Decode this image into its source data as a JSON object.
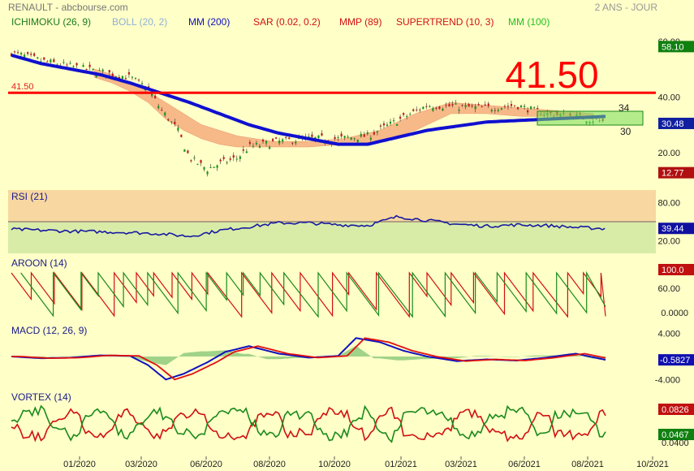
{
  "header": {
    "title": "RENAULT - abcbourse.com",
    "period": "2 ANS - JOUR",
    "indicators": [
      {
        "label": "ICHIMOKU (26, 9)",
        "color": "#1a7a1a"
      },
      {
        "label": "BOLL (20, 2)",
        "color": "#8fb0d8"
      },
      {
        "label": "MM (200)",
        "color": "#1010c0"
      },
      {
        "label": "SAR (0.02, 0.2)",
        "color": "#d01010"
      },
      {
        "label": "MMP (89)",
        "color": "#d01010"
      },
      {
        "label": "SUPERTREND (10, 3)",
        "color": "#d01010"
      },
      {
        "label": "MM (100)",
        "color": "#20c020"
      }
    ]
  },
  "chart_data": [
    {
      "type": "line",
      "panel": "price",
      "y_ticks": [
        "60.00",
        "40.00",
        "20.00"
      ],
      "ylim": [
        8,
        62
      ],
      "horizontal_level": 41.5,
      "level_label_big": "41.50",
      "level_label_small": "41.50",
      "box_label_top": "34",
      "box_label_bottom": "30",
      "value_tags": [
        {
          "text": "58.10",
          "value": 58.1,
          "bg": "#108010"
        },
        {
          "text": "30.48",
          "value": 30.48,
          "bg": "#1020a0"
        },
        {
          "text": "12.77",
          "value": 12.77,
          "bg": "#b01010"
        }
      ],
      "series": [
        {
          "name": "Prix",
          "x": [
            0,
            5,
            10,
            15,
            20,
            23,
            25,
            28,
            30,
            33,
            35,
            38,
            40,
            45,
            50,
            55,
            60,
            70,
            80,
            85,
            88,
            90,
            95,
            100
          ],
          "values": [
            56,
            53,
            51,
            49,
            47,
            43,
            36,
            28,
            18,
            14,
            16,
            18,
            22,
            24,
            25,
            25,
            26,
            37,
            36,
            37,
            35,
            34,
            33,
            31
          ]
        },
        {
          "name": "MM (200)",
          "x": [
            0,
            5,
            10,
            15,
            20,
            30,
            40,
            45,
            50,
            55,
            60,
            70,
            80,
            90,
            100
          ],
          "values": [
            55,
            52,
            50,
            48,
            45,
            38,
            30,
            27,
            25,
            23,
            23,
            28,
            31,
            32,
            33
          ]
        }
      ],
      "zones": [
        {
          "name": "Ichimoku",
          "x": [
            14,
            17,
            20,
            23,
            26,
            29,
            32,
            35,
            38,
            41,
            44,
            50,
            56,
            62,
            68,
            74,
            80,
            86,
            92,
            98
          ],
          "top": [
            50,
            48,
            45,
            42,
            38,
            34,
            30,
            28,
            26,
            25,
            24,
            24,
            25,
            28,
            34,
            38,
            37,
            36,
            35,
            34
          ],
          "bottom": [
            47,
            45,
            42,
            38,
            32,
            28,
            25,
            23,
            22,
            22,
            22,
            22,
            23,
            24,
            28,
            34,
            34,
            33,
            33,
            32
          ]
        }
      ]
    },
    {
      "type": "line",
      "panel": "RSI",
      "title": "RSI (21)",
      "y_ticks": [
        "80.00",
        "20.00"
      ],
      "ylim": [
        0,
        100
      ],
      "value_tag": {
        "text": "39.44",
        "value": 39.44,
        "bg": "#1010a0"
      },
      "series": [
        {
          "name": "RSI (21)",
          "x": [
            0,
            10,
            20,
            25,
            30,
            35,
            40,
            45,
            50,
            55,
            60,
            65,
            70,
            75,
            80,
            85,
            90,
            95,
            100
          ],
          "values": [
            38,
            35,
            33,
            31,
            27,
            36,
            42,
            48,
            48,
            45,
            44,
            58,
            52,
            46,
            43,
            45,
            44,
            41,
            39
          ]
        }
      ]
    },
    {
      "type": "line",
      "panel": "AROON",
      "title": "AROON (14)",
      "y_ticks": [
        "60.00",
        "0.0000"
      ],
      "ylim": [
        0,
        100
      ],
      "value_tag": {
        "text": "100.0",
        "value": 100,
        "bg": "#c01010"
      }
    },
    {
      "type": "line",
      "panel": "MACD",
      "title": "MACD (12, 26, 9)",
      "y_ticks": [
        "4.000",
        "-4.000"
      ],
      "ylim": [
        -5.5,
        5.5
      ],
      "value_tag": {
        "text": "-0.5827",
        "value": -0.5827,
        "bg": "#1010b0"
      },
      "series": [
        {
          "name": "MACD",
          "x": [
            0,
            5,
            10,
            15,
            20,
            23,
            26,
            29,
            33,
            36,
            40,
            45,
            50,
            55,
            58,
            62,
            66,
            70,
            75,
            80,
            85,
            90,
            95,
            100
          ],
          "values": [
            0,
            -0.3,
            -0.2,
            0.2,
            0.1,
            -1.5,
            -4,
            -3,
            -1,
            0.8,
            1.8,
            0.5,
            -0.2,
            0.1,
            3.2,
            2.5,
            1,
            0,
            -0.8,
            -0.5,
            -0.7,
            -0.2,
            0.5,
            -0.58
          ]
        }
      ]
    },
    {
      "type": "line",
      "panel": "VORTEX",
      "title": "VORTEX (14)",
      "value_tags": [
        {
          "text": "0.0826",
          "bg": "#c01010"
        },
        {
          "text": "0.0467",
          "bg": "#108010"
        },
        {
          "text": "0.0400",
          "bg": null
        }
      ]
    }
  ],
  "x_axis": {
    "ticks": [
      "01/2020",
      "03/2020",
      "06/2020",
      "08/2020",
      "10/2020",
      "01/2021",
      "03/2021",
      "06/2021",
      "08/2021",
      "10/2021"
    ]
  }
}
